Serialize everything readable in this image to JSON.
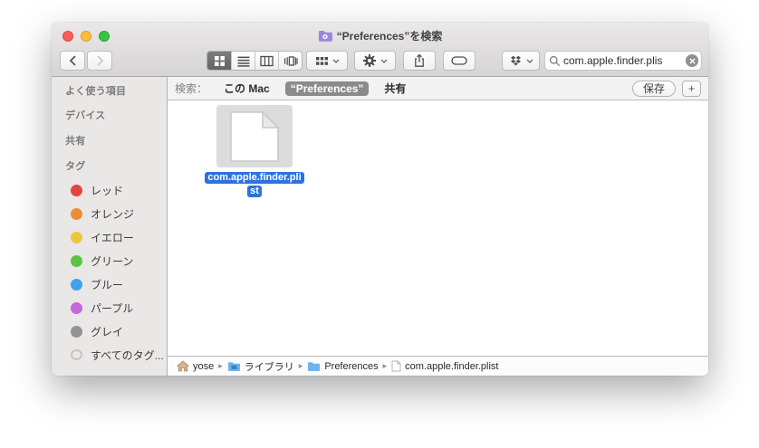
{
  "window": {
    "title": "“Preferences”を検索"
  },
  "toolbar": {
    "search": {
      "value": "com.apple.finder.plis"
    }
  },
  "scope_bar": {
    "label": "検索：",
    "scopes": [
      {
        "label": "この Mac",
        "selected": false
      },
      {
        "label": "“Preferences”",
        "selected": true
      },
      {
        "label": "共有",
        "selected": false
      }
    ],
    "save_button": "保存",
    "add_button": "+"
  },
  "sidebar": {
    "sections": [
      {
        "title": "よく使う項目"
      },
      {
        "title": "デバイス"
      },
      {
        "title": "共有"
      },
      {
        "title": "タグ"
      }
    ],
    "tags": [
      {
        "label": "レッド",
        "color": "#e1453e"
      },
      {
        "label": "オレンジ",
        "color": "#ea8f35"
      },
      {
        "label": "イエロー",
        "color": "#eec63e"
      },
      {
        "label": "グリーン",
        "color": "#5fc244"
      },
      {
        "label": "ブルー",
        "color": "#3fa2ec"
      },
      {
        "label": "パープル",
        "color": "#c468d7"
      },
      {
        "label": "グレイ",
        "color": "#929292"
      },
      {
        "label": "すべてのタグ...",
        "color": "#c4c4c4"
      }
    ]
  },
  "content": {
    "file": {
      "name_line1": "com.apple.finder.pli",
      "name_line2": "st",
      "selection_color": "#2e72dd"
    }
  },
  "path_bar": {
    "separator": "▸",
    "items": [
      {
        "label": "yose"
      },
      {
        "label": "ライブラリ"
      },
      {
        "label": "Preferences"
      },
      {
        "label": "com.apple.finder.plist"
      }
    ]
  }
}
